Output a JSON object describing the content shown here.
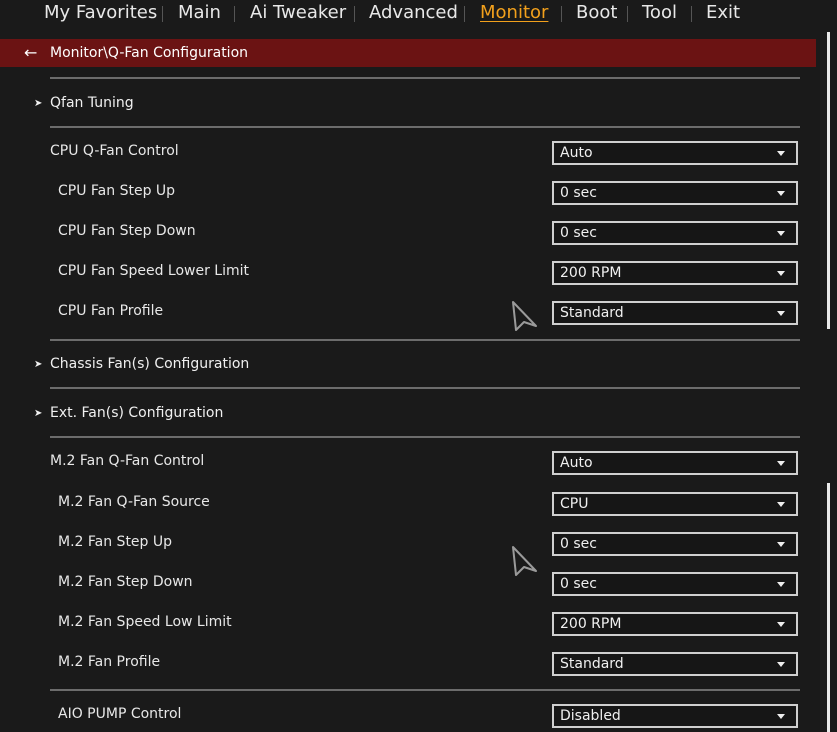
{
  "nav": {
    "tabs": [
      "My Favorites",
      "Main",
      "Ai Tweaker",
      "Advanced",
      "Monitor",
      "Boot",
      "Tool",
      "Exit"
    ],
    "active": "Monitor"
  },
  "breadcrumb": {
    "back_icon": "←",
    "path": "Monitor\\Q-Fan Configuration"
  },
  "submenus": {
    "qfan_tuning": "Qfan Tuning",
    "chassis": "Chassis Fan(s) Configuration",
    "ext": "Ext. Fan(s) Configuration"
  },
  "cpu": {
    "control": {
      "label": "CPU Q-Fan Control",
      "value": "Auto"
    },
    "step_up": {
      "label": "CPU Fan Step Up",
      "value": "0 sec"
    },
    "step_down": {
      "label": "CPU Fan Step Down",
      "value": "0 sec"
    },
    "lower_limit": {
      "label": "CPU Fan Speed Lower Limit",
      "value": "200 RPM"
    },
    "profile": {
      "label": "CPU Fan Profile",
      "value": "Standard"
    }
  },
  "m2": {
    "control": {
      "label": "M.2 Fan Q-Fan Control",
      "value": "Auto"
    },
    "source": {
      "label": "M.2 Fan Q-Fan Source",
      "value": "CPU"
    },
    "step_up": {
      "label": "M.2 Fan Step Up",
      "value": "0 sec"
    },
    "step_down": {
      "label": "M.2 Fan Step Down",
      "value": "0 sec"
    },
    "low_limit": {
      "label": "M.2 Fan Speed Low Limit",
      "value": "200 RPM"
    },
    "profile": {
      "label": "M.2 Fan Profile",
      "value": "Standard"
    }
  },
  "aio": {
    "control": {
      "label": "AIO PUMP Control",
      "value": "Disabled"
    }
  },
  "colors": {
    "background": "#1a1a1a",
    "breadcrumb_bar": "#6b1313",
    "active_tab": "#f2a01c",
    "divider": "#6c6c6c"
  }
}
